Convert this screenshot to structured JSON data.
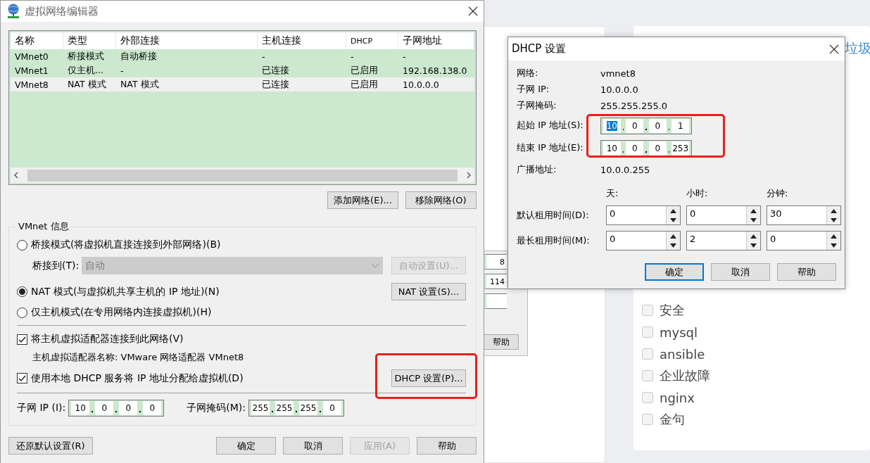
{
  "page": {
    "heading": "垃圾",
    "tags": [
      {
        "label": "安全",
        "checked": false
      },
      {
        "label": "mysql",
        "checked": false
      },
      {
        "label": "ansible",
        "checked": false
      },
      {
        "label": "企业故障",
        "checked": false
      },
      {
        "label": "nginx",
        "checked": false
      },
      {
        "label": "金句",
        "checked": false
      }
    ]
  },
  "behind_window": {
    "fields": [
      "8",
      "114"
    ],
    "help_button": "帮助"
  },
  "editor": {
    "title": "虚拟网络编辑器",
    "table": {
      "columns": [
        "名称",
        "类型",
        "外部连接",
        "主机连接",
        "DHCP",
        "子网地址"
      ],
      "rows": [
        {
          "cells": [
            "VMnet0",
            "桥接模式",
            "自动桥接",
            "-",
            "-",
            "-"
          ],
          "selected": false
        },
        {
          "cells": [
            "VMnet1",
            "仅主机...",
            "-",
            "已连接",
            "已启用",
            "192.168.138.0"
          ],
          "selected": false
        },
        {
          "cells": [
            "VMnet8",
            "NAT 模式",
            "NAT 模式",
            "已连接",
            "已启用",
            "10.0.0.0"
          ],
          "selected": true
        }
      ]
    },
    "add_button": "添加网络(E)...",
    "remove_button": "移除网络(O)",
    "group": {
      "title": "VMnet 信息",
      "modes": [
        {
          "label": "桥接模式(将虚拟机直接连接到外部网络)(B)",
          "selected": false
        },
        {
          "label": "NAT 模式(与虚拟机共享主机的 IP 地址)(N)",
          "selected": true
        },
        {
          "label": "仅主机模式(在专用网络内连接虚拟机)(H)",
          "selected": false
        }
      ],
      "bridge_label": "桥接到(T):",
      "bridge_select": {
        "value": "自动",
        "disabled": true
      },
      "auto_button": {
        "label": "自动设置(U)...",
        "disabled": true
      },
      "nat_button": "NAT 设置(S)...",
      "connect_adapter": {
        "label": "将主机虚拟适配器连接到此网络(V)",
        "checked": true
      },
      "adapter_name": "主机虚拟适配器名称: VMware 网络适配器 VMnet8",
      "use_dhcp": {
        "label": "使用本地 DHCP 服务将 IP 地址分配给虚拟机(D)",
        "checked": true
      },
      "dhcp_button": "DHCP 设置(P)...",
      "subnet_ip": {
        "label": "子网 IP (I):",
        "octets": [
          "10",
          "0",
          "0",
          "0"
        ]
      },
      "subnet_mask": {
        "label": "子网掩码(M):",
        "octets": [
          "255",
          "255",
          "255",
          "0"
        ]
      }
    },
    "restore_button": "还原默认设置(R)",
    "buttons": [
      {
        "label": "确定",
        "disabled": false
      },
      {
        "label": "取消",
        "disabled": false
      },
      {
        "label": "应用(A)",
        "disabled": true
      },
      {
        "label": "帮助",
        "disabled": false
      }
    ]
  },
  "dhcp": {
    "title": "DHCP 设置",
    "info": [
      {
        "label": "网络:",
        "value": "vmnet8"
      },
      {
        "label": "子网 IP:",
        "value": "10.0.0.0"
      },
      {
        "label": "子网掩码:",
        "value": "255.255.255.0"
      }
    ],
    "start_ip": {
      "label": "起始 IP 地址(S):",
      "octets": [
        {
          "value": "10",
          "selected": true
        },
        {
          "value": "0",
          "selected": false
        },
        {
          "value": "0",
          "selected": false
        },
        {
          "value": "1",
          "selected": false
        }
      ]
    },
    "end_ip": {
      "label": "结束 IP 地址(E):",
      "octets": [
        {
          "value": "10",
          "selected": false
        },
        {
          "value": "0",
          "selected": false
        },
        {
          "value": "0",
          "selected": false
        },
        {
          "value": "253",
          "selected": false
        }
      ]
    },
    "broadcast": {
      "label": "广播地址:",
      "value": "10.0.0.255"
    },
    "lease_columns": [
      "天:",
      "小时:",
      "分钟:"
    ],
    "leases": [
      {
        "label": "默认租用时间(D):",
        "values": [
          "0",
          "0",
          "30"
        ]
      },
      {
        "label": "最长租用时间(M):",
        "values": [
          "0",
          "2",
          "0"
        ]
      }
    ],
    "buttons": [
      {
        "label": "确定",
        "default": true
      },
      {
        "label": "取消",
        "default": false
      },
      {
        "label": "帮助",
        "default": false
      }
    ]
  }
}
